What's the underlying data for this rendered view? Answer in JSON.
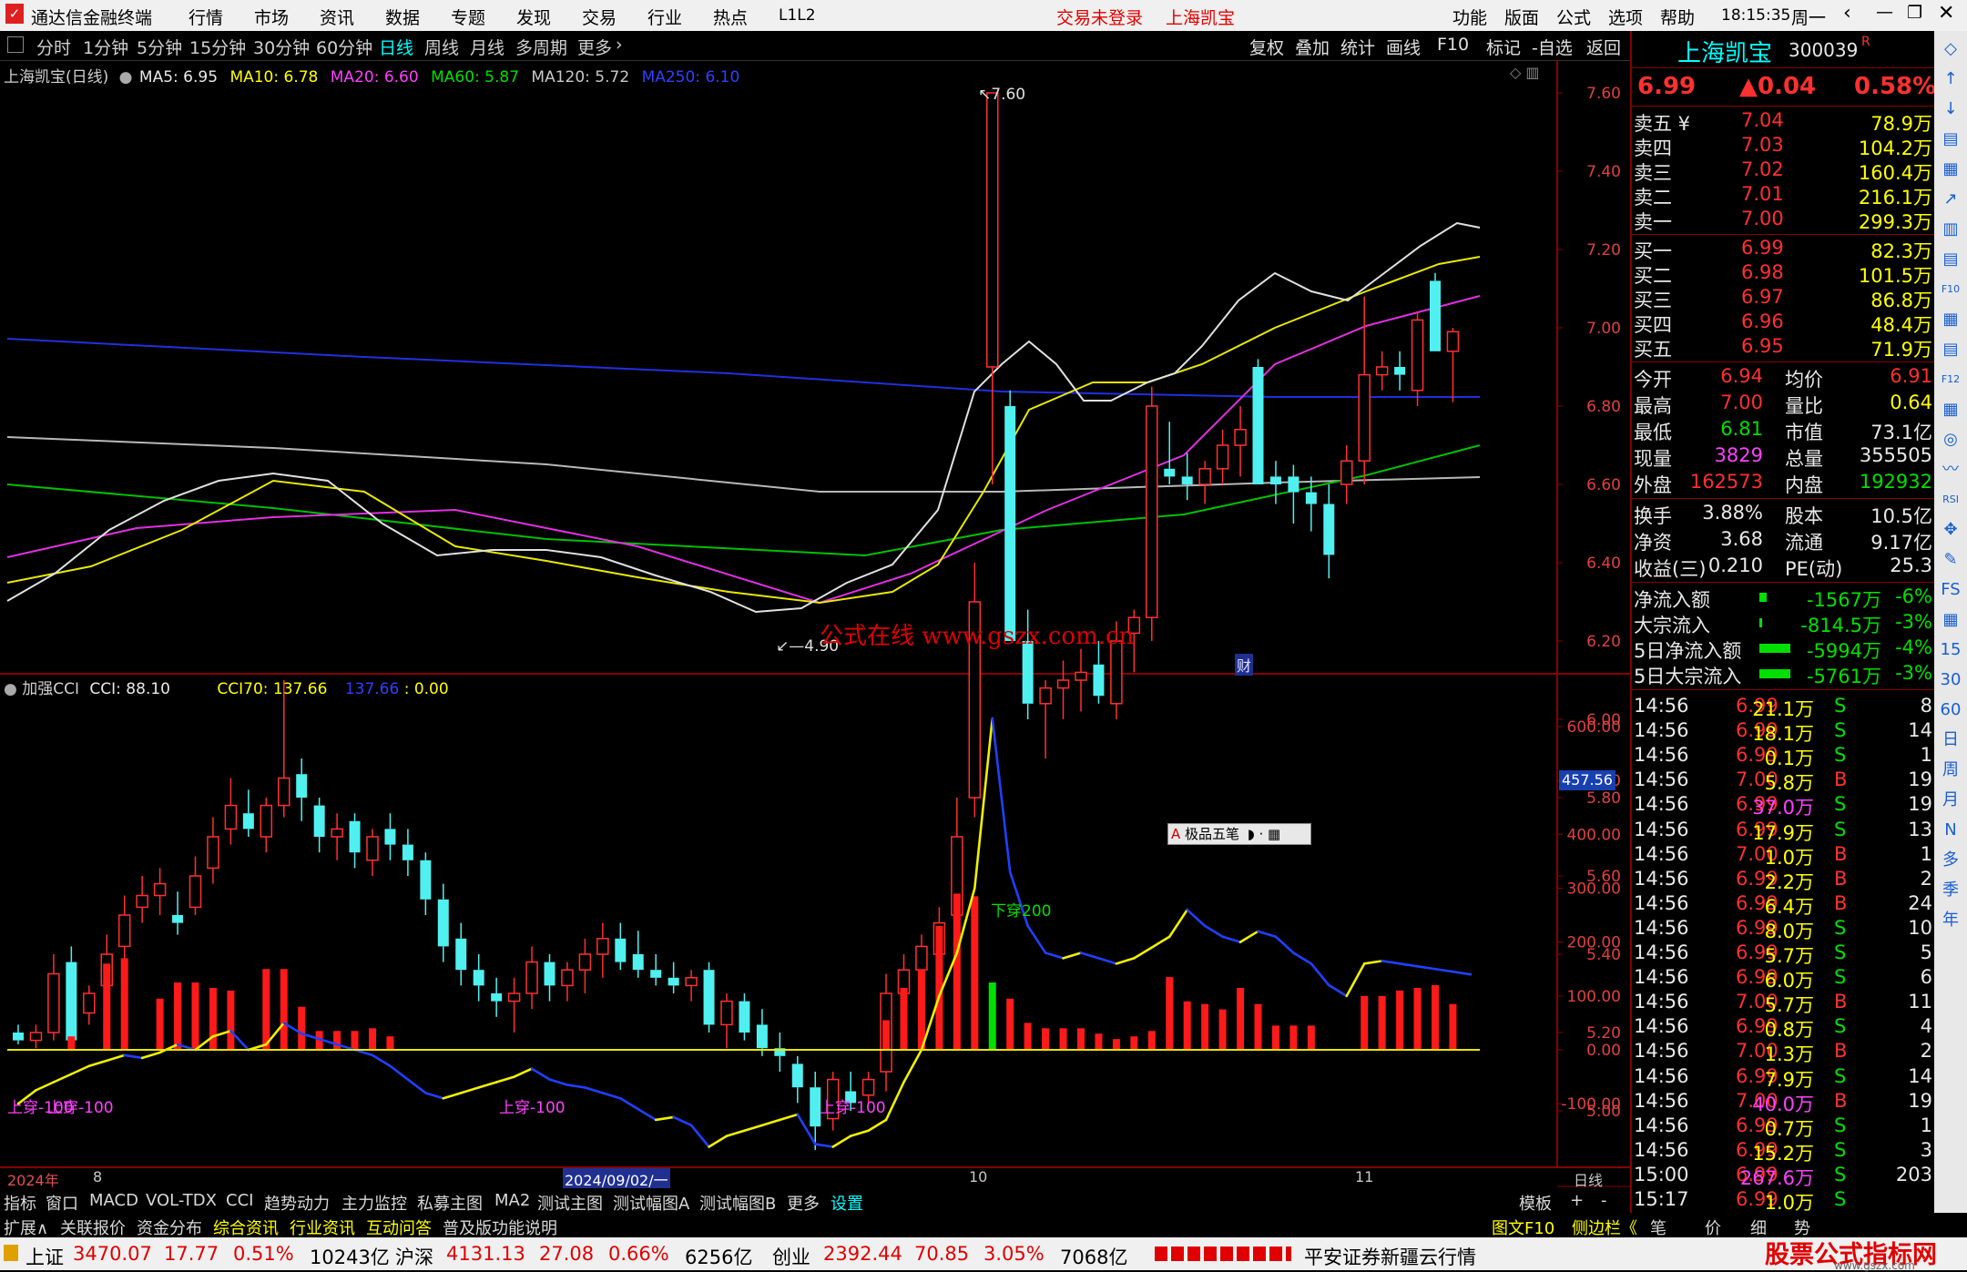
{
  "titlebar": {
    "app_name": "通达信金融终端",
    "menus": [
      "行情",
      "市场",
      "资讯",
      "数据",
      "专题",
      "发现",
      "交易",
      "行业",
      "热点",
      "L1L2"
    ],
    "login_status": "交易未登录",
    "stock_name": "上海凯宝",
    "right_menus": [
      "功能",
      "版面",
      "公式",
      "选项",
      "帮助"
    ],
    "clock": "18:15:35",
    "weekday": "周一"
  },
  "periodbar": {
    "periods": [
      "分时",
      "1分钟",
      "5分钟",
      "15分钟",
      "30分钟",
      "60分钟",
      "日线",
      "周线",
      "月线",
      "多周期",
      "更多"
    ],
    "active": "日线",
    "right_buttons": [
      "复权",
      "叠加",
      "统计",
      "画线",
      "F10",
      "标记",
      "-自选",
      "返回"
    ]
  },
  "main_chart": {
    "legend_title": "上海凯宝(日线)",
    "ma5": "MA5: 6.95",
    "ma10": "MA10: 6.78",
    "ma20": "MA20: 6.60",
    "ma60": "MA60: 5.87",
    "ma120": "MA120: 5.72",
    "ma250": "MA250: 6.10",
    "price_axis": [
      "7.60",
      "7.40",
      "7.20",
      "7.00",
      "6.80",
      "6.60",
      "6.40",
      "6.20",
      "6.00",
      "5.80",
      "5.60",
      "5.40",
      "5.20",
      "5.00"
    ],
    "high_label": "7.60",
    "low_label": "4.90",
    "watermark": "公式在线 www.gszx.com.cn",
    "fin_mark": "财"
  },
  "sub_chart": {
    "legend_title": "加强CCI",
    "cci_value": "CCI: 88.10",
    "cci70": "CCI70: 137.66",
    "v2": "137.66",
    "v3": ": 0.00",
    "axis": [
      "600.00",
      "500.00",
      "400.00",
      "300.00",
      "200.00",
      "100.00",
      "0.00",
      "-100.00"
    ],
    "current_tag": "457.56",
    "labels": [
      "上穿-100",
      "上穿-100",
      "上穿-100",
      "上穿-100",
      "下穿200"
    ],
    "floating_tool": "极品五笔"
  },
  "date_axis": {
    "labels": [
      "2024年",
      "8",
      "2024/09/02/一",
      "10",
      "11"
    ],
    "period": "日线"
  },
  "chart_data": {
    "type": "candlestick",
    "title": "上海凯宝(日线)",
    "ylim": [
      4.85,
      7.7
    ],
    "candles": [
      [
        5.2,
        5.22,
        5.17,
        5.18
      ],
      [
        5.18,
        5.22,
        5.16,
        5.2
      ],
      [
        5.2,
        5.4,
        5.18,
        5.35
      ],
      [
        5.38,
        5.42,
        5.16,
        5.18
      ],
      [
        5.25,
        5.32,
        5.22,
        5.3
      ],
      [
        5.32,
        5.45,
        5.28,
        5.4
      ],
      [
        5.42,
        5.55,
        5.38,
        5.5
      ],
      [
        5.52,
        5.6,
        5.48,
        5.55
      ],
      [
        5.55,
        5.62,
        5.5,
        5.58
      ],
      [
        5.5,
        5.56,
        5.45,
        5.48
      ],
      [
        5.52,
        5.65,
        5.5,
        5.6
      ],
      [
        5.62,
        5.75,
        5.58,
        5.7
      ],
      [
        5.72,
        5.85,
        5.68,
        5.78
      ],
      [
        5.76,
        5.82,
        5.7,
        5.72
      ],
      [
        5.7,
        5.8,
        5.66,
        5.78
      ],
      [
        5.78,
        6.1,
        5.75,
        5.85
      ],
      [
        5.86,
        5.9,
        5.74,
        5.8
      ],
      [
        5.78,
        5.8,
        5.66,
        5.7
      ],
      [
        5.7,
        5.76,
        5.64,
        5.72
      ],
      [
        5.74,
        5.76,
        5.62,
        5.66
      ],
      [
        5.64,
        5.72,
        5.6,
        5.7
      ],
      [
        5.72,
        5.76,
        5.64,
        5.68
      ],
      [
        5.68,
        5.72,
        5.6,
        5.64
      ],
      [
        5.64,
        5.66,
        5.5,
        5.54
      ],
      [
        5.54,
        5.58,
        5.38,
        5.42
      ],
      [
        5.44,
        5.48,
        5.32,
        5.36
      ],
      [
        5.36,
        5.4,
        5.28,
        5.32
      ],
      [
        5.3,
        5.34,
        5.24,
        5.28
      ],
      [
        5.28,
        5.34,
        5.2,
        5.3
      ],
      [
        5.3,
        5.42,
        5.26,
        5.38
      ],
      [
        5.38,
        5.4,
        5.28,
        5.32
      ],
      [
        5.32,
        5.38,
        5.28,
        5.36
      ],
      [
        5.36,
        5.44,
        5.3,
        5.4
      ],
      [
        5.4,
        5.48,
        5.34,
        5.44
      ],
      [
        5.44,
        5.48,
        5.36,
        5.38
      ],
      [
        5.4,
        5.46,
        5.34,
        5.36
      ],
      [
        5.36,
        5.4,
        5.32,
        5.34
      ],
      [
        5.34,
        5.38,
        5.3,
        5.32
      ],
      [
        5.32,
        5.36,
        5.28,
        5.34
      ],
      [
        5.36,
        5.38,
        5.2,
        5.22
      ],
      [
        5.22,
        5.3,
        5.16,
        5.28
      ],
      [
        5.28,
        5.3,
        5.18,
        5.2
      ],
      [
        5.22,
        5.26,
        5.14,
        5.16
      ],
      [
        5.16,
        5.2,
        5.1,
        5.14
      ],
      [
        5.12,
        5.14,
        5.02,
        5.06
      ],
      [
        5.06,
        5.1,
        4.9,
        4.96
      ],
      [
        4.98,
        5.1,
        4.95,
        5.08
      ],
      [
        5.05,
        5.1,
        5.0,
        5.02
      ],
      [
        5.04,
        5.1,
        5.02,
        5.08
      ],
      [
        5.1,
        5.35,
        5.05,
        5.3
      ],
      [
        5.3,
        5.4,
        5.25,
        5.36
      ],
      [
        5.36,
        5.45,
        5.3,
        5.42
      ],
      [
        5.4,
        5.52,
        5.36,
        5.48
      ],
      [
        5.5,
        5.8,
        5.45,
        5.7
      ],
      [
        5.8,
        6.4,
        5.75,
        6.3
      ],
      [
        6.9,
        7.6,
        6.6,
        7.6
      ],
      [
        6.8,
        6.84,
        6.2,
        6.2
      ],
      [
        6.2,
        6.28,
        6.0,
        6.04
      ],
      [
        6.04,
        6.1,
        5.9,
        6.08
      ],
      [
        6.08,
        6.15,
        6.0,
        6.1
      ],
      [
        6.1,
        6.18,
        6.02,
        6.12
      ],
      [
        6.14,
        6.2,
        6.04,
        6.06
      ],
      [
        6.04,
        6.25,
        6.0,
        6.2
      ],
      [
        6.22,
        6.28,
        6.12,
        6.26
      ],
      [
        6.26,
        6.85,
        6.2,
        6.8
      ],
      [
        6.64,
        6.76,
        6.6,
        6.62
      ],
      [
        6.62,
        6.68,
        6.56,
        6.6
      ],
      [
        6.6,
        6.66,
        6.55,
        6.64
      ],
      [
        6.64,
        6.74,
        6.6,
        6.7
      ],
      [
        6.7,
        6.8,
        6.62,
        6.74
      ],
      [
        6.9,
        6.92,
        6.6,
        6.6
      ],
      [
        6.62,
        6.66,
        6.55,
        6.6
      ],
      [
        6.62,
        6.65,
        6.5,
        6.58
      ],
      [
        6.58,
        6.62,
        6.48,
        6.55
      ],
      [
        6.55,
        6.6,
        6.36,
        6.42
      ],
      [
        6.6,
        6.7,
        6.55,
        6.66
      ],
      [
        6.66,
        7.08,
        6.6,
        6.88
      ],
      [
        6.88,
        6.94,
        6.84,
        6.9
      ],
      [
        6.9,
        6.94,
        6.84,
        6.88
      ],
      [
        6.84,
        7.04,
        6.8,
        7.02
      ],
      [
        7.12,
        7.14,
        6.94,
        6.94
      ],
      [
        6.94,
        7.0,
        6.81,
        6.99
      ]
    ],
    "cci": [
      -100,
      -75,
      -60,
      -45,
      -30,
      -20,
      -10,
      -15,
      -5,
      10,
      0,
      25,
      35,
      0,
      10,
      50,
      30,
      20,
      10,
      0,
      -10,
      -30,
      -55,
      -80,
      -90,
      -80,
      -70,
      -60,
      -50,
      -35,
      -55,
      -65,
      -70,
      -80,
      -90,
      -110,
      -130,
      -125,
      -140,
      -180,
      -160,
      -150,
      -140,
      -130,
      -120,
      -175,
      -180,
      -160,
      -150,
      -130,
      -60,
      0,
      100,
      180,
      300,
      615,
      330,
      230,
      180,
      170,
      180,
      170,
      160,
      170,
      190,
      210,
      260,
      230,
      210,
      200,
      220,
      210,
      180,
      160,
      120,
      100,
      160,
      165,
      160,
      155,
      150,
      145,
      140
    ],
    "hist": [
      0,
      0,
      0,
      25,
      0,
      160,
      170,
      0,
      95,
      125,
      125,
      115,
      110,
      0,
      150,
      150,
      80,
      35,
      35,
      35,
      40,
      25,
      0,
      0,
      0,
      0,
      0,
      0,
      0,
      0,
      0,
      0,
      0,
      0,
      0,
      0,
      0,
      0,
      0,
      0,
      0,
      0,
      0,
      0,
      0,
      0,
      0,
      0,
      0,
      55,
      115,
      150,
      230,
      290,
      285,
      125,
      95,
      50,
      40,
      40,
      40,
      30,
      20,
      25,
      35,
      135,
      90,
      85,
      75,
      115,
      85,
      45,
      45,
      45,
      0,
      0,
      100,
      100,
      110,
      115,
      120,
      85,
      0
    ],
    "hist_green_index": 55
  },
  "quote": {
    "name": "上海凯宝",
    "code": "300039",
    "code_flag": "R",
    "price": "6.99",
    "change": "▲0.04",
    "pct": "0.58%",
    "sell": [
      {
        "label": "卖五",
        "mark": "¥",
        "price": "7.04",
        "vol": "78.9万"
      },
      {
        "label": "卖四",
        "mark": "",
        "price": "7.03",
        "vol": "104.2万"
      },
      {
        "label": "卖三",
        "mark": "",
        "price": "7.02",
        "vol": "160.4万"
      },
      {
        "label": "卖二",
        "mark": "",
        "price": "7.01",
        "vol": "216.1万"
      },
      {
        "label": "卖一",
        "mark": "",
        "price": "7.00",
        "vol": "299.3万"
      }
    ],
    "buy": [
      {
        "label": "买一",
        "price": "6.99",
        "vol": "82.3万"
      },
      {
        "label": "买二",
        "price": "6.98",
        "vol": "101.5万"
      },
      {
        "label": "买三",
        "price": "6.97",
        "vol": "86.8万"
      },
      {
        "label": "买四",
        "price": "6.96",
        "vol": "48.4万"
      },
      {
        "label": "买五",
        "price": "6.95",
        "vol": "71.9万"
      }
    ],
    "stats": [
      {
        "l1": "今开",
        "v1": "6.94",
        "l2": "均价",
        "v2": "6.91",
        "c1": "red",
        "c2": "red"
      },
      {
        "l1": "最高",
        "v1": "7.00",
        "l2": "量比",
        "v2": "0.64",
        "c1": "red",
        "c2": "yel"
      },
      {
        "l1": "最低",
        "v1": "6.81",
        "l2": "市值",
        "v2": "73.1亿",
        "c1": "grn",
        "c2": "wht"
      },
      {
        "l1": "现量",
        "v1": "3829",
        "l2": "总量",
        "v2": "355505",
        "c1": "mag",
        "c2": "wht"
      },
      {
        "l1": "外盘",
        "v1": "162573",
        "l2": "内盘",
        "v2": "192932",
        "c1": "red",
        "c2": "grn"
      }
    ],
    "stats2": [
      {
        "l1": "换手",
        "v1": "3.88%",
        "l2": "股本",
        "v2": "10.5亿"
      },
      {
        "l1": "净资",
        "v1": "3.68",
        "l2": "流通",
        "v2": "9.17亿"
      },
      {
        "l1": "收益(三)",
        "v1": "0.210",
        "l2": "PE(动)",
        "v2": "25.3"
      }
    ],
    "flows": [
      {
        "label": "净流入额",
        "value": "-1567万",
        "pct": "-6%",
        "bar": 8
      },
      {
        "label": "大宗流入",
        "value": "-814.5万",
        "pct": "-3%",
        "bar": 3
      },
      {
        "label": "5日净流入额",
        "value": "-5994万",
        "pct": "-4%",
        "bar": 34
      },
      {
        "label": "5日大宗流入",
        "value": "-5761万",
        "pct": "-3%",
        "bar": 34
      }
    ],
    "ticks": [
      [
        "14:56",
        "6.99",
        "21.1万",
        "S",
        "8"
      ],
      [
        "14:56",
        "6.99",
        "18.1万",
        "S",
        "14"
      ],
      [
        "14:56",
        "6.99",
        "0.1万",
        "S",
        "1"
      ],
      [
        "14:56",
        "7.00",
        "5.8万",
        "B",
        "19"
      ],
      [
        "14:56",
        "6.99",
        "37.0万",
        "S",
        "19"
      ],
      [
        "14:56",
        "6.99",
        "17.9万",
        "S",
        "13"
      ],
      [
        "14:56",
        "7.00",
        "1.0万",
        "B",
        "1"
      ],
      [
        "14:56",
        "6.99",
        "2.2万",
        "B",
        "2"
      ],
      [
        "14:56",
        "6.99",
        "6.4万",
        "B",
        "24"
      ],
      [
        "14:56",
        "6.99",
        "8.0万",
        "S",
        "10"
      ],
      [
        "14:56",
        "6.99",
        "5.7万",
        "S",
        "5"
      ],
      [
        "14:56",
        "6.99",
        "6.0万",
        "S",
        "6"
      ],
      [
        "14:56",
        "7.00",
        "5.7万",
        "B",
        "11"
      ],
      [
        "14:56",
        "6.99",
        "0.8万",
        "S",
        "4"
      ],
      [
        "14:56",
        "7.00",
        "1.3万",
        "B",
        "2"
      ],
      [
        "14:56",
        "6.99",
        "7.9万",
        "S",
        "14"
      ],
      [
        "14:56",
        "7.00",
        "40.0万",
        "B",
        "19"
      ],
      [
        "14:56",
        "6.99",
        "0.7万",
        "S",
        "1"
      ],
      [
        "14:56",
        "6.99",
        "15.2万",
        "S",
        "3"
      ],
      [
        "15:00",
        "6.99",
        "267.6万",
        "S",
        "203"
      ],
      [
        "15:17",
        "6.99",
        "1.0万",
        "S",
        ""
      ]
    ]
  },
  "toolstrip": [
    "◇",
    "↑",
    "↓",
    "▤",
    "▦",
    "↗",
    "▥",
    "▤",
    "F10",
    "▦",
    "▤",
    "F12",
    "▦",
    "◎",
    "〰",
    "RSI",
    "✥",
    "✎",
    "FS",
    "▦",
    "15",
    "30",
    "60",
    "日",
    "周",
    "月",
    "N",
    "多",
    "季",
    "年"
  ],
  "tabbar1": {
    "tabs": [
      "指标",
      "窗口",
      "MACD",
      "VOL-TDX",
      "CCI",
      "趋势动力",
      "主力监控",
      "私募主图",
      "MA2",
      "测试主图",
      "测试幅图A",
      "测试幅图B",
      "更多",
      "设置"
    ],
    "right": [
      "模板",
      "+",
      "-"
    ]
  },
  "tabbar2": {
    "tabs": [
      "扩展∧",
      "关联报价",
      "资金分布",
      "综合资讯",
      "行业资讯",
      "互动问答",
      "普及版功能说明"
    ],
    "right": [
      "图文F10",
      "侧边栏《",
      "笔",
      "价",
      "细",
      "势"
    ]
  },
  "statusbar": {
    "idx1_name": "上证",
    "idx1_val": "3470.07",
    "idx1_chg": "17.77",
    "idx1_pct": "0.51%",
    "idx1_amt": "10243亿",
    "idx2_name": "沪深",
    "idx2_val": "4131.13",
    "idx2_chg": "27.08",
    "idx2_pct": "0.66%",
    "idx2_amt": "6256亿",
    "idx3_name": "创业",
    "idx3_val": "2392.44",
    "idx3_chg": "70.85",
    "idx3_pct": "3.05%",
    "idx3_amt": "7068亿",
    "broker": "平安证券新疆云行情",
    "logo_text": "股票公式指标网",
    "logo_url": "www.gszx.com"
  }
}
